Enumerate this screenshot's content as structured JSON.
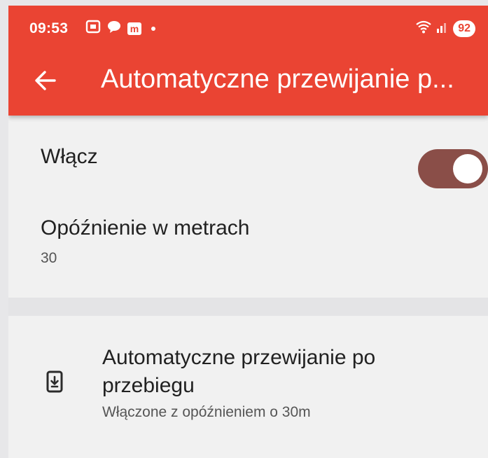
{
  "status_bar": {
    "time": "09:53",
    "battery": "92",
    "icons": [
      "screenshot-icon",
      "chat-icon",
      "m-app-icon",
      "notification-dot",
      "wifi-icon",
      "signal-icon"
    ]
  },
  "app_bar": {
    "title": "Automatyczne przewijanie p...",
    "back_icon": "arrow-back-icon",
    "color": "#ea4433"
  },
  "settings": {
    "enable": {
      "label": "Włącz",
      "state": "on",
      "switch_color": "#8a4e48"
    },
    "delay": {
      "label": "Opóźnienie w metrach",
      "value": "30"
    }
  },
  "summary": {
    "icon": "phone-download-icon",
    "title": "Automatyczne przewijanie po przebiegu",
    "subtitle": "Włączone z opóźnieniem o 30m"
  }
}
